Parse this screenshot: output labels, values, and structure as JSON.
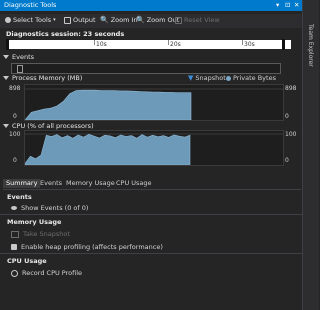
{
  "window": {
    "title": "Diagnostic Tools",
    "controls": [
      "▾",
      "⊡",
      "✕"
    ],
    "side_panel_label": "Team Explorer"
  },
  "toolbar": {
    "select_tools": "Select Tools",
    "output": "Output",
    "zoom_in": "Zoom In",
    "zoom_out": "Zoom Out",
    "reset_view": "Reset View"
  },
  "session": {
    "label": "Diagnostics session: 23 seconds",
    "ticks": [
      "10s",
      "20s",
      "30s"
    ]
  },
  "events_section": {
    "title": "Events"
  },
  "memory_section": {
    "title": "Process Memory (MB)",
    "legend_snapshot": "Snapshot",
    "legend_private": "Private Bytes",
    "y_max": "898",
    "y_min": "0",
    "series": [
      0,
      25,
      30,
      35,
      38,
      45,
      60,
      85,
      95,
      96,
      96,
      96,
      95,
      95,
      95,
      94,
      94,
      93,
      92,
      91,
      90,
      90,
      89,
      89,
      88,
      88,
      88
    ]
  },
  "cpu_section": {
    "title": "CPU (% of all processors)",
    "y_max": "100",
    "y_min": "0",
    "series": [
      5,
      28,
      20,
      32,
      96,
      92,
      98,
      88,
      95,
      86,
      97,
      90,
      99,
      93,
      87,
      96,
      94,
      88,
      97,
      92,
      95,
      86,
      98,
      90,
      96,
      91,
      95,
      89,
      97,
      93,
      90,
      96
    ]
  },
  "tabs": [
    "Summary",
    "Events",
    "Memory Usage",
    "CPU Usage"
  ],
  "summary": {
    "events_head": "Events",
    "show_events": "Show Events (0 of 0)",
    "memory_head": "Memory Usage",
    "take_snapshot": "Take Snapshot",
    "heap_profiling": "Enable heap profiling (affects performance)",
    "cpu_head": "CPU Usage",
    "record_cpu": "Record CPU Profile"
  },
  "colors": {
    "accent": "#007acc",
    "chart_fill": "#6c9ab8",
    "chart_stroke": "#8fb8d6",
    "background": "#252526"
  }
}
